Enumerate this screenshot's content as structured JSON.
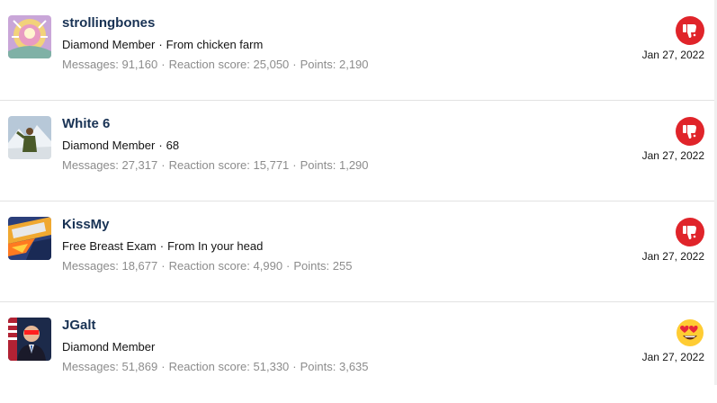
{
  "members": [
    {
      "username": "strollingbones",
      "title": "Diamond Member",
      "detail": "From chicken farm",
      "messages": "Messages: 91,160",
      "reaction_score": "Reaction score: 25,050",
      "points": "Points: 2,190",
      "date": "Jan 27, 2022",
      "reaction_icon": "thumbs-down-icon"
    },
    {
      "username": "White 6",
      "title": "Diamond Member",
      "detail": "68",
      "messages": "Messages: 27,317",
      "reaction_score": "Reaction score: 15,771",
      "points": "Points: 1,290",
      "date": "Jan 27, 2022",
      "reaction_icon": "thumbs-down-icon"
    },
    {
      "username": "KissMy",
      "title": "Free Breast Exam",
      "detail": "From In your head",
      "messages": "Messages: 18,677",
      "reaction_score": "Reaction score: 4,990",
      "points": "Points: 255",
      "date": "Jan 27, 2022",
      "reaction_icon": "thumbs-down-icon"
    },
    {
      "username": "JGalt",
      "title": "Diamond Member",
      "detail": "",
      "messages": "Messages: 51,869",
      "reaction_score": "Reaction score: 51,330",
      "points": "Points: 3,635",
      "date": "Jan 27, 2022",
      "reaction_icon": "heart-eyes-icon"
    }
  ],
  "separator": "·",
  "colors": {
    "username": "#183254",
    "muted": "#8c8c8c",
    "dislike_red": "#e0242a",
    "divider": "#e2e2e2"
  }
}
